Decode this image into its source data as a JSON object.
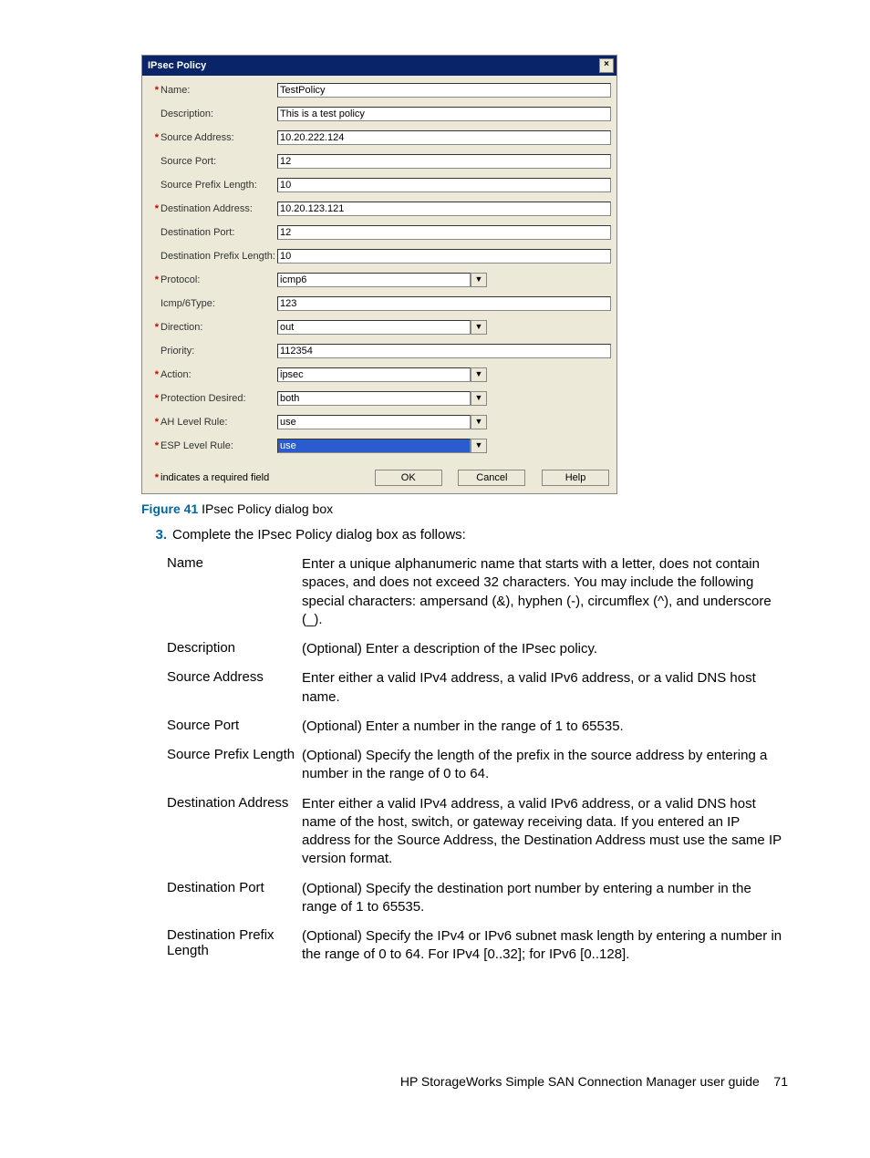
{
  "dialog": {
    "title": "IPsec Policy",
    "fields": {
      "name": {
        "label": "Name:",
        "value": "TestPolicy",
        "required": true
      },
      "description": {
        "label": "Description:",
        "value": "This is a test policy",
        "required": false
      },
      "source_addr": {
        "label": "Source Address:",
        "value": "10.20.222.124",
        "required": true
      },
      "source_port": {
        "label": "Source Port:",
        "value": "12",
        "required": false
      },
      "source_prefix": {
        "label": "Source Prefix Length:",
        "value": "10",
        "required": false
      },
      "dest_addr": {
        "label": "Destination Address:",
        "value": "10.20.123.121",
        "required": true
      },
      "dest_port": {
        "label": "Destination Port:",
        "value": "12",
        "required": false
      },
      "dest_prefix": {
        "label": "Destination Prefix Length:",
        "value": "10",
        "required": false
      },
      "protocol": {
        "label": "Protocol:",
        "value": "icmp6",
        "required": true
      },
      "icmp_type": {
        "label": "Icmp/6Type:",
        "value": "123",
        "required": false
      },
      "direction": {
        "label": "Direction:",
        "value": "out",
        "required": true
      },
      "priority": {
        "label": "Priority:",
        "value": "112354",
        "required": false
      },
      "action": {
        "label": "Action:",
        "value": "ipsec",
        "required": true
      },
      "protection": {
        "label": "Protection Desired:",
        "value": "both",
        "required": true
      },
      "ah_rule": {
        "label": "AH Level Rule:",
        "value": "use",
        "required": true
      },
      "esp_rule": {
        "label": "ESP Level Rule:",
        "value": "use",
        "required": true
      }
    },
    "required_note": "indicates a required field",
    "buttons": {
      "ok": "OK",
      "cancel": "Cancel",
      "help": "Help"
    }
  },
  "caption": {
    "fignum": "Figure 41",
    "text": "IPsec Policy dialog box"
  },
  "step": {
    "num": "3.",
    "text": "Complete the IPsec Policy dialog box as follows:"
  },
  "descriptions": [
    {
      "label": "Name",
      "text": "Enter a unique alphanumeric name that starts with a letter, does not contain spaces, and does not exceed 32 characters. You may include the following special characters: ampersand (&), hyphen (-), circumflex (^), and underscore (_)."
    },
    {
      "label": "Description",
      "text": "(Optional) Enter a description of the IPsec policy."
    },
    {
      "label": "Source Address",
      "text": "Enter either a valid IPv4 address, a valid IPv6 address, or a valid DNS host name."
    },
    {
      "label": "Source Port",
      "text": "(Optional) Enter a number in the range of 1 to 65535."
    },
    {
      "label": "Source Prefix Length",
      "text": "(Optional) Specify the length of the prefix in the source address by entering a number in the range of 0 to 64."
    },
    {
      "label": "Destination Address",
      "text": "Enter either a valid IPv4 address, a valid IPv6 address, or a valid DNS host name of the host, switch, or gateway receiving data. If you entered an IP address for the Source Address, the Destination Address must use the same IP version format."
    },
    {
      "label": "Destination Port",
      "text": "(Optional) Specify the destination port number by entering a number in the range of 1 to 65535."
    },
    {
      "label": "Destination Prefix Length",
      "text": "(Optional) Specify the IPv4 or IPv6 subnet mask length by entering a number in the range of 0 to 64. For IPv4 [0..32]; for IPv6 [0..128]."
    }
  ],
  "footer": {
    "text": "HP StorageWorks Simple SAN Connection Manager user guide",
    "page": "71"
  }
}
